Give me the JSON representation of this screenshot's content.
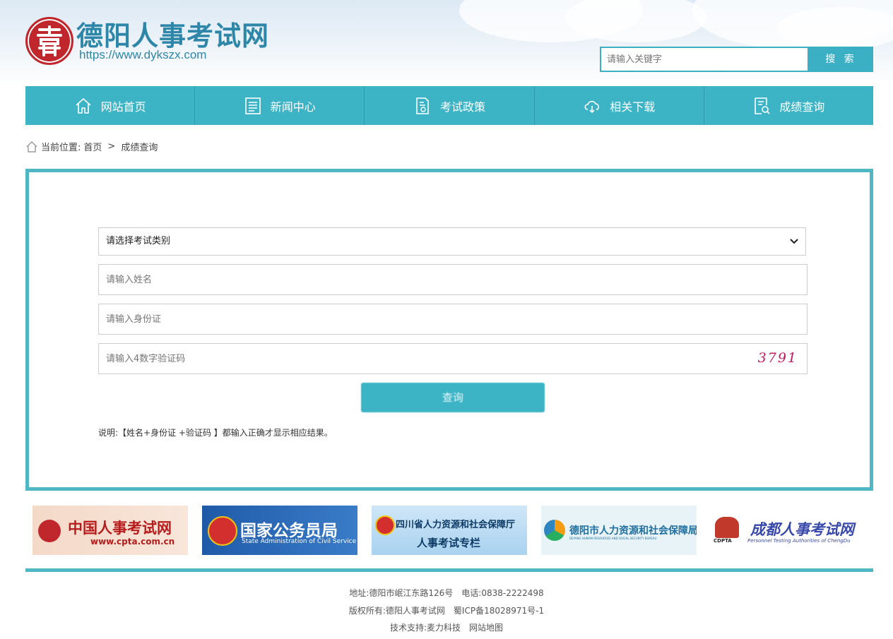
{
  "header": {
    "site_title": "德阳人事考试网",
    "site_url": "https://www.dykszx.com",
    "search_placeholder": "请输入关键字",
    "search_button": "搜 索"
  },
  "nav": {
    "items": [
      {
        "label": "网站首页",
        "icon": "home-icon"
      },
      {
        "label": "新闻中心",
        "icon": "news-icon"
      },
      {
        "label": "考试政策",
        "icon": "policy-document-icon"
      },
      {
        "label": "相关下载",
        "icon": "cloud-download-icon"
      },
      {
        "label": "成绩查询",
        "icon": "search-document-icon"
      }
    ]
  },
  "breadcrumb": {
    "prefix": "当前位置:",
    "home": "首页",
    "separator": ">",
    "current": "成绩查询"
  },
  "form": {
    "exam_type_selected": "请选择考试类别",
    "name_placeholder": "请输入姓名",
    "id_placeholder": "请输入身份证",
    "captcha_placeholder": "请输入4数字验证码",
    "captcha_value": "3791",
    "submit_label": "查询",
    "note": "说明:【姓名+身份证 +验证码 】都输入正确才显示相应结果。"
  },
  "partners": [
    {
      "name": "中国人事考试网",
      "sub": "www.cpta.com.cn"
    },
    {
      "name": "国家公务员局",
      "sub": "State Administration of Civil Service"
    },
    {
      "name": "四川省人力资源和社会保障厅",
      "sub": "人事考试专栏"
    },
    {
      "name": "德阳市人力资源和社会保障局",
      "sub": "DEYANG HUMAN RESOURCES AND SOCIAL SECURITY BUREAU"
    },
    {
      "name": "成都人事考试网",
      "sub": "Personnel Testing Authorities of ChengDu",
      "badge": "CDPTA"
    }
  ],
  "footer": {
    "address": "地址:德阳市岷江东路126号",
    "phone": "电话:0838-2222498",
    "copyright": "版权所有:德阳人事考试网",
    "icp": "蜀ICP备18028971号-1",
    "support": "技术支持:麦力科技",
    "sitemap": "网站地图"
  },
  "colors": {
    "brand": "#3db4c6",
    "title": "#2e86a8",
    "logo_red": "#c0272d",
    "captcha": "#c2185b"
  }
}
